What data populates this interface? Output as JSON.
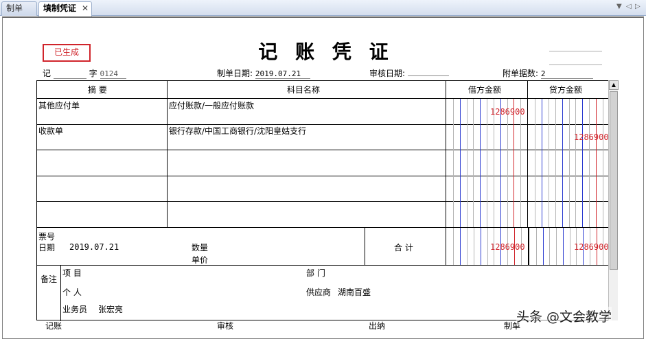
{
  "tabs": [
    {
      "label": "制单",
      "active": false
    },
    {
      "label": "填制凭证",
      "active": true
    }
  ],
  "tab_controls": {
    "dropdown": "▼",
    "left": "◁",
    "right": "▷"
  },
  "voucher": {
    "status": "已生成",
    "title": "记 账 凭 证",
    "type_label": "记",
    "no_label": "字",
    "number": "0124",
    "date_label": "制单日期:",
    "date": "2019.07.21",
    "audit_label": "审核日期:",
    "audit_date": "",
    "attach_label": "附单据数:",
    "attach_count": "2"
  },
  "table": {
    "headers": {
      "summary": "摘 要",
      "subject": "科目名称",
      "debit": "借方金额",
      "credit": "贷方金额"
    },
    "rows": [
      {
        "summary": "其他应付单",
        "subject": "应付账款/一般应付账款",
        "debit": "1286900",
        "credit": ""
      },
      {
        "summary": "收款单",
        "subject": "银行存款/中国工商银行/沈阳皇姑支行",
        "debit": "",
        "credit": "1286900"
      },
      {
        "summary": "",
        "subject": "",
        "debit": "",
        "credit": ""
      },
      {
        "summary": "",
        "subject": "",
        "debit": "",
        "credit": ""
      },
      {
        "summary": "",
        "subject": "",
        "debit": "",
        "credit": ""
      }
    ],
    "ticket_label": "票号",
    "ticket_date_label": "日期",
    "ticket_date": "2019.07.21",
    "qty_label": "数量",
    "price_label": "单价",
    "total_label": "合 计",
    "total_debit": "1286900",
    "total_credit": "1286900",
    "notes": {
      "label": "备注",
      "project_label": "项  目",
      "dept_label": "部  门",
      "person_label": "个  人",
      "supplier_label": "供应商",
      "supplier": "湖南百盛",
      "salesman_label": "业务员",
      "salesman": "张宏亮"
    }
  },
  "footer": {
    "bookkeep": "记账",
    "audit": "审核",
    "cashier": "出纳",
    "maker": "制单"
  },
  "watermark": "头条 @文会教学",
  "colors": {
    "accent_red": "#d0242b",
    "grid_blue": "#2b3bd0",
    "grid_red": "#d0242b"
  }
}
